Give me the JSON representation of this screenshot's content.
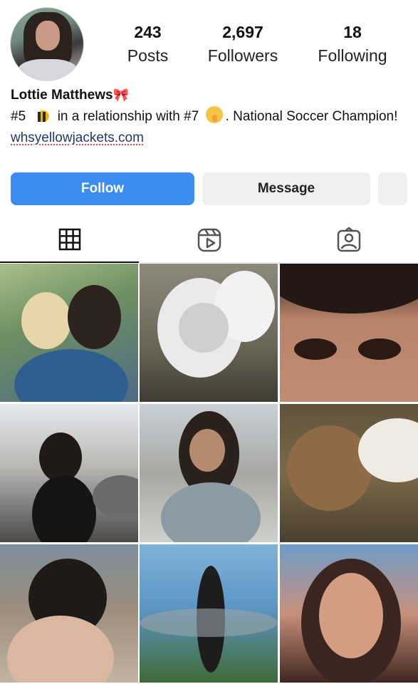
{
  "profile": {
    "stats": {
      "posts_count": "243",
      "posts_label": "Posts",
      "followers_count": "2,697",
      "followers_label": "Followers",
      "following_count": "18",
      "following_label": "Following"
    },
    "name": "Lottie Matthews",
    "name_emoji": "🎀",
    "bio_part1": "#5",
    "bio_part2": "in a relationship with #7",
    "bio_part3": ". National Soccer Champion!",
    "link": "whsyellowjackets.com"
  },
  "actions": {
    "follow_label": "Follow",
    "message_label": "Message"
  },
  "tabs": [
    {
      "icon": "grid-icon"
    },
    {
      "icon": "reels-icon"
    },
    {
      "icon": "tagged-icon"
    }
  ],
  "colors": {
    "accent": "#3b8ef0",
    "secondary_button": "#efefef",
    "link": "#213a6b"
  },
  "posts": [
    {
      "icon": "photo"
    },
    {
      "icon": "photo"
    },
    {
      "icon": "photo"
    },
    {
      "icon": "photo"
    },
    {
      "icon": "photo"
    },
    {
      "icon": "photo"
    },
    {
      "icon": "photo"
    },
    {
      "icon": "photo"
    },
    {
      "icon": "photo"
    }
  ]
}
